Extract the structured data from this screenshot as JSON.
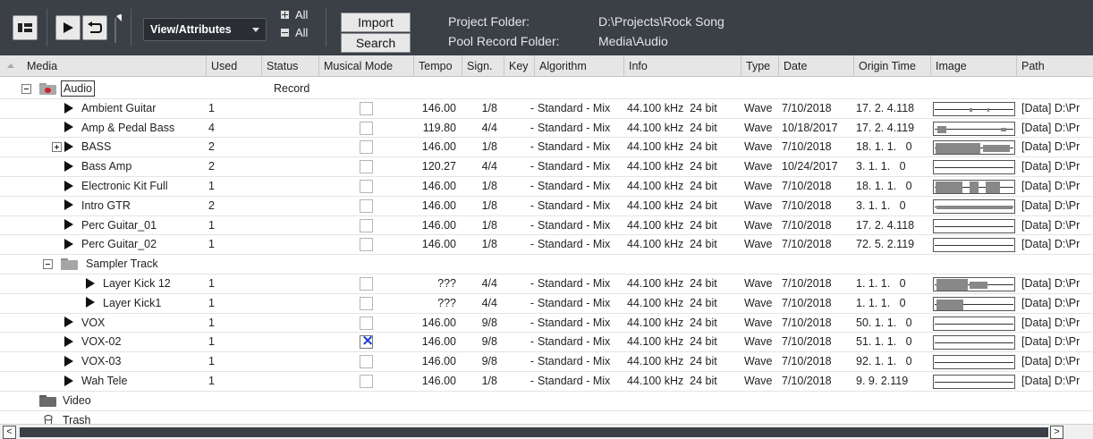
{
  "toolbar": {
    "view_label": "View/Attributes",
    "expand_all_label": "All",
    "collapse_all_label": "All",
    "import_label": "Import",
    "search_label": "Search",
    "project_folder_label": "Project Folder:",
    "project_folder_value": "D:\\Projects\\Rock Song",
    "pool_record_label": "Pool Record Folder:",
    "pool_record_value": "Media\\Audio"
  },
  "columns": {
    "media": "Media",
    "used": "Used",
    "status": "Status",
    "musical_mode": "Musical Mode",
    "tempo": "Tempo",
    "sign": "Sign.",
    "key": "Key",
    "algorithm": "Algorithm",
    "info": "Info",
    "type": "Type",
    "date": "Date",
    "origin_time": "Origin Time",
    "image": "Image",
    "path": "Path"
  },
  "folders": {
    "audio": {
      "name": "Audio",
      "status": "Record"
    },
    "sampler": {
      "name": "Sampler Track"
    },
    "video": {
      "name": "Video"
    },
    "trash": {
      "name": "Trash"
    }
  },
  "clips": [
    {
      "name": "Ambient Guitar",
      "used": "1",
      "musical": false,
      "tempo": "146.00",
      "sign": "1/8",
      "key": "-",
      "algorithm": "Standard - Mix",
      "info": "44.100 kHz  24 bit",
      "type": "Wave",
      "date": "7/10/2018",
      "origin": "17. 2. 4.118",
      "path": "[Data] D:\\Pr"
    },
    {
      "name": "Amp & Pedal Bass",
      "used": "4",
      "musical": false,
      "tempo": "119.80",
      "sign": "4/4",
      "key": "-",
      "algorithm": "Standard - Mix",
      "info": "44.100 kHz  24 bit",
      "type": "Wave",
      "date": "10/18/2017",
      "origin": "17. 2. 4.119",
      "path": "[Data] D:\\Pr"
    },
    {
      "name": "BASS",
      "used": "2",
      "musical": false,
      "tempo": "146.00",
      "sign": "1/8",
      "key": "-",
      "algorithm": "Standard - Mix",
      "info": "44.100 kHz  24 bit",
      "type": "Wave",
      "date": "7/10/2018",
      "origin": "18. 1. 1.   0",
      "path": "[Data] D:\\Pr"
    },
    {
      "name": "Bass Amp",
      "used": "2",
      "musical": false,
      "tempo": "120.27",
      "sign": "4/4",
      "key": "-",
      "algorithm": "Standard - Mix",
      "info": "44.100 kHz  24 bit",
      "type": "Wave",
      "date": "10/24/2017",
      "origin": "3. 1. 1.   0",
      "path": "[Data] D:\\Pr"
    },
    {
      "name": "Electronic Kit Full",
      "used": "1",
      "musical": false,
      "tempo": "146.00",
      "sign": "1/8",
      "key": "-",
      "algorithm": "Standard - Mix",
      "info": "44.100 kHz  24 bit",
      "type": "Wave",
      "date": "7/10/2018",
      "origin": "18. 1. 1.   0",
      "path": "[Data] D:\\Pr"
    },
    {
      "name": "Intro GTR",
      "used": "2",
      "musical": false,
      "tempo": "146.00",
      "sign": "1/8",
      "key": "-",
      "algorithm": "Standard - Mix",
      "info": "44.100 kHz  24 bit",
      "type": "Wave",
      "date": "7/10/2018",
      "origin": "3. 1. 1.   0",
      "path": "[Data] D:\\Pr"
    },
    {
      "name": "Perc Guitar_01",
      "used": "1",
      "musical": false,
      "tempo": "146.00",
      "sign": "1/8",
      "key": "-",
      "algorithm": "Standard - Mix",
      "info": "44.100 kHz  24 bit",
      "type": "Wave",
      "date": "7/10/2018",
      "origin": "17. 2. 4.118",
      "path": "[Data] D:\\Pr"
    },
    {
      "name": "Perc Guitar_02",
      "used": "1",
      "musical": false,
      "tempo": "146.00",
      "sign": "1/8",
      "key": "-",
      "algorithm": "Standard - Mix",
      "info": "44.100 kHz  24 bit",
      "type": "Wave",
      "date": "7/10/2018",
      "origin": "72. 5. 2.119",
      "path": "[Data] D:\\Pr"
    }
  ],
  "sampler_clips": [
    {
      "name": "Layer Kick 12",
      "used": "1",
      "musical": false,
      "tempo": "???",
      "sign": "4/4",
      "key": "-",
      "algorithm": "Standard - Mix",
      "info": "44.100 kHz  24 bit",
      "type": "Wave",
      "date": "7/10/2018",
      "origin": "1. 1. 1.   0",
      "path": "[Data] D:\\Pr"
    },
    {
      "name": "Layer Kick1",
      "used": "1",
      "musical": false,
      "tempo": "???",
      "sign": "4/4",
      "key": "-",
      "algorithm": "Standard - Mix",
      "info": "44.100 kHz  24 bit",
      "type": "Wave",
      "date": "7/10/2018",
      "origin": "1. 1. 1.   0",
      "path": "[Data] D:\\Pr"
    }
  ],
  "clips_after": [
    {
      "name": "VOX",
      "used": "1",
      "musical": false,
      "tempo": "146.00",
      "sign": "9/8",
      "key": "-",
      "algorithm": "Standard - Mix",
      "info": "44.100 kHz  24 bit",
      "type": "Wave",
      "date": "7/10/2018",
      "origin": "50. 1. 1.   0",
      "path": "[Data] D:\\Pr"
    },
    {
      "name": "VOX-02",
      "used": "1",
      "musical": true,
      "tempo": "146.00",
      "sign": "9/8",
      "key": "-",
      "algorithm": "Standard - Mix",
      "info": "44.100 kHz  24 bit",
      "type": "Wave",
      "date": "7/10/2018",
      "origin": "51. 1. 1.   0",
      "path": "[Data] D:\\Pr"
    },
    {
      "name": "VOX-03",
      "used": "1",
      "musical": false,
      "tempo": "146.00",
      "sign": "9/8",
      "key": "-",
      "algorithm": "Standard - Mix",
      "info": "44.100 kHz  24 bit",
      "type": "Wave",
      "date": "7/10/2018",
      "origin": "92. 1. 1.   0",
      "path": "[Data] D:\\Pr"
    },
    {
      "name": "Wah Tele",
      "used": "1",
      "musical": false,
      "tempo": "146.00",
      "sign": "1/8",
      "key": "-",
      "algorithm": "Standard - Mix",
      "info": "44.100 kHz  24 bit",
      "type": "Wave",
      "date": "7/10/2018",
      "origin": "9. 9. 2.119",
      "path": "[Data] D:\\Pr"
    }
  ],
  "scroll": {
    "left_arrow": "<",
    "right_arrow": ">"
  }
}
